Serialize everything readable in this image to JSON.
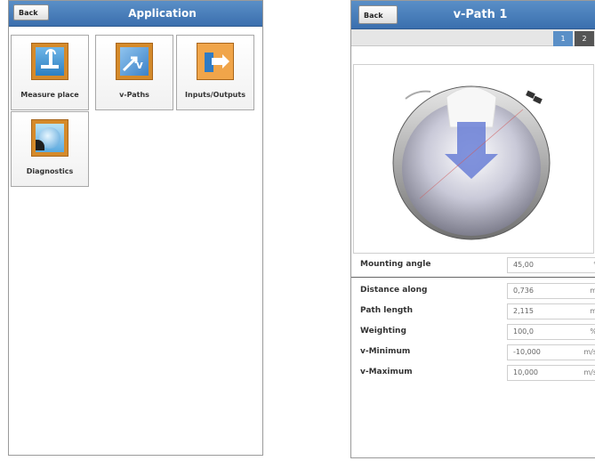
{
  "left": {
    "back_label": "Back",
    "title": "Application",
    "tiles": [
      {
        "label": "Measure place",
        "icon": "measure-place-icon"
      },
      {
        "label": "v-Paths",
        "icon": "v-paths-icon"
      },
      {
        "label": "Inputs/Outputs",
        "icon": "inputs-outputs-icon"
      },
      {
        "label": "Diagnostics",
        "icon": "diagnostics-icon"
      }
    ]
  },
  "right": {
    "back_label": "Back",
    "title": "v-Path 1",
    "tabs": [
      "1",
      "2"
    ],
    "fields": [
      {
        "label": "Mounting angle",
        "value": "45,00",
        "unit": "°"
      },
      {
        "label": "Distance along",
        "value": "0,736",
        "unit": "m"
      },
      {
        "label": "Path length",
        "value": "2,115",
        "unit": "m"
      },
      {
        "label": "Weighting",
        "value": "100,0",
        "unit": "%"
      },
      {
        "label": "v-Minimum",
        "value": "-10,000",
        "unit": "m/s"
      },
      {
        "label": "v-Maximum",
        "value": "10,000",
        "unit": "m/s"
      }
    ]
  },
  "colors": {
    "titlebar": "#4a80bd",
    "tile_icon": "#d58a2a",
    "active_tab": "#5a8fc7",
    "inactive_tab": "#555555"
  }
}
